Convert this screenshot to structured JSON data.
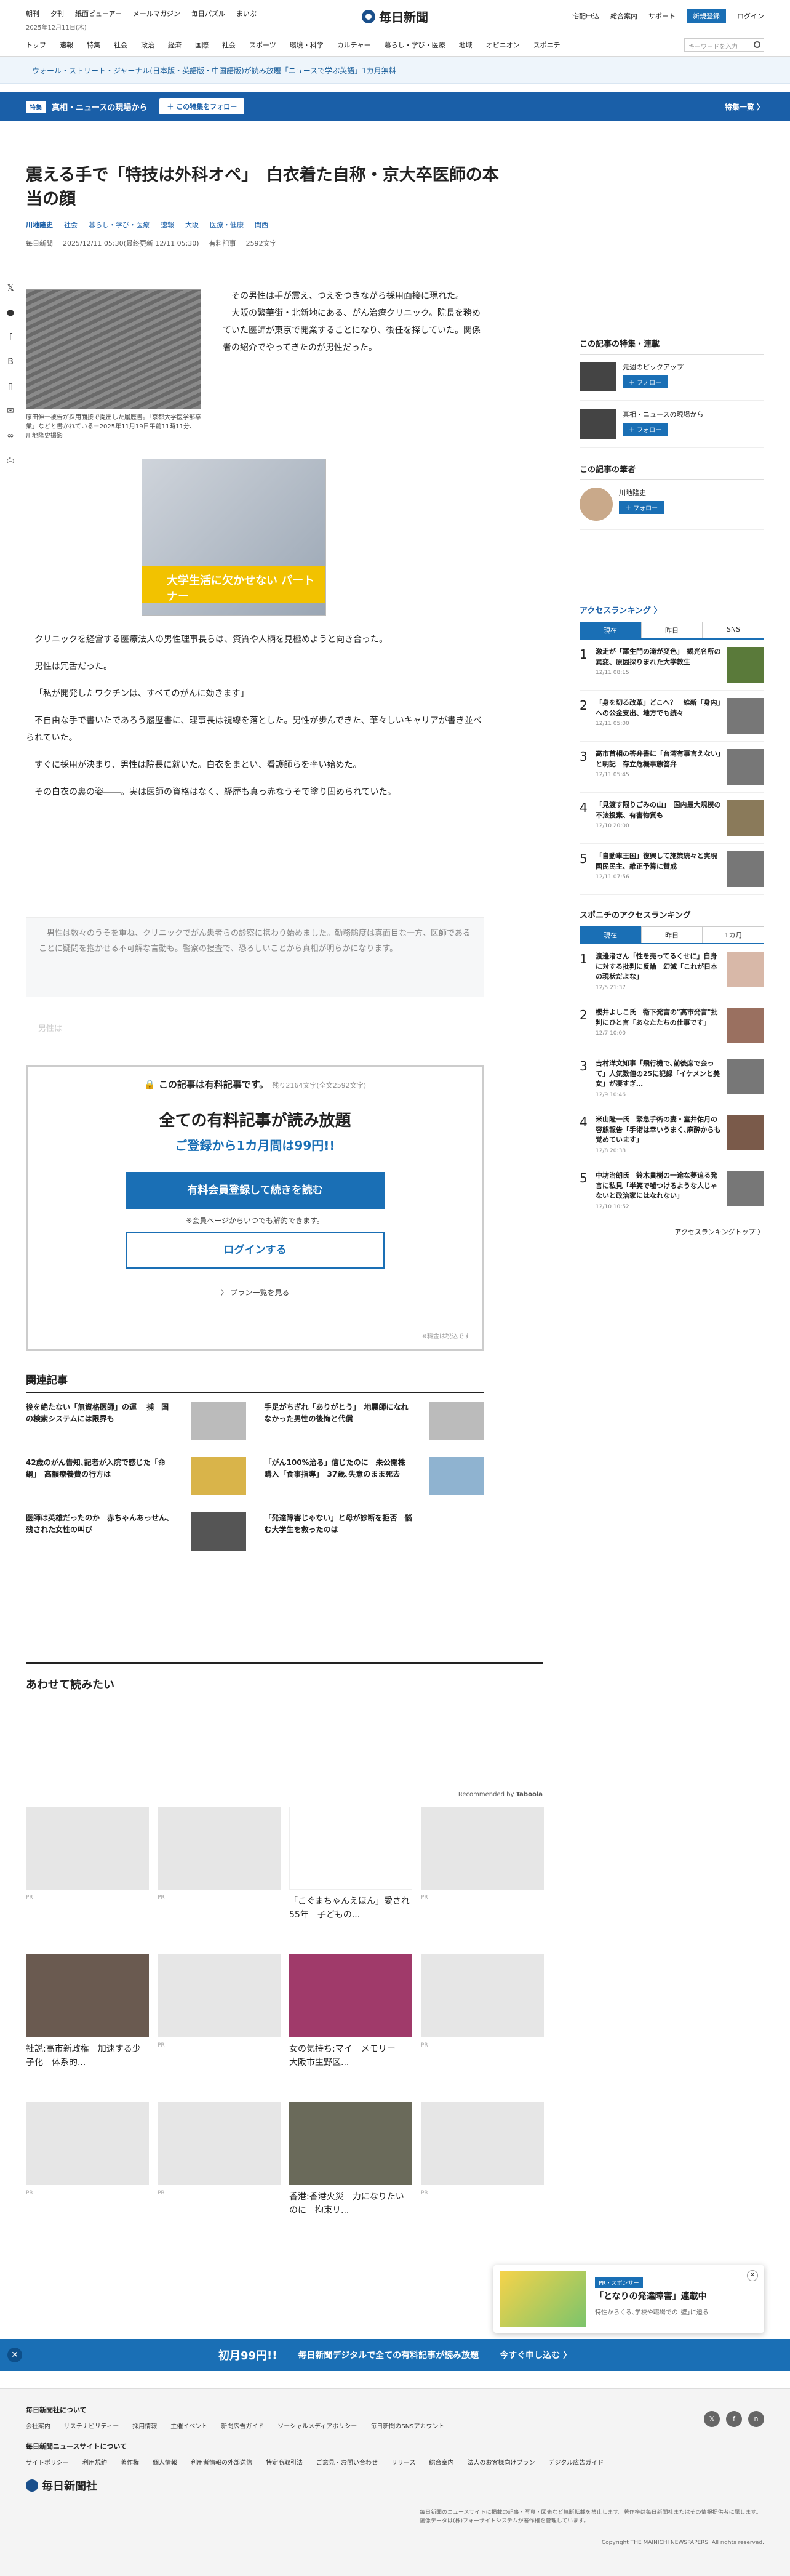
{
  "topbar": {
    "links": [
      "朝刊",
      "夕刊",
      "紙面ビューアー",
      "メールマガジン",
      "毎日パズル",
      "まいぷ"
    ],
    "date": "2025年12月11日(木)",
    "logo": "毎日新聞",
    "right": [
      "宅配申込",
      "総合案内",
      "サポート"
    ],
    "register": "新規登録",
    "login": "ログイン"
  },
  "nav": {
    "items": [
      "トップ",
      "速報",
      "特集",
      "社会",
      "政治",
      "経済",
      "国際",
      "社会",
      "スポーツ",
      "環境・科学",
      "カルチャー",
      "暮らし・学び・医療",
      "地域",
      "オピニオン",
      "スポニチ"
    ],
    "search_placeholder": "キーワードを入力"
  },
  "promo": {
    "text": "ウォール・ストリート・ジャーナル(日本版・英語版・中国語版)が読み放題「ニュースで学ぶ英語」1カ月無料"
  },
  "special": {
    "tag": "特集",
    "title": "真相・ニュースの現場から",
    "follow": "＋ この特集をフォロー",
    "all": "特集一覧 〉"
  },
  "article": {
    "title": "震える手で「特技は外科オペ」　白衣着た自称・京大卒医師の本当の顔",
    "author": "川地隆史",
    "tags": [
      "社会",
      "暮らし・学び・医療",
      "速報",
      "大阪",
      "医療・健康",
      "関西"
    ],
    "source": "毎日新聞",
    "date": "2025/12/11 05:30(最終更新 12/11 05:30)",
    "save": "有料記事",
    "chars": "2592文字",
    "caption": "原田伸一被告が採用面接で提出した履歴書。「京都大学医学部卒業」などと書かれている＝2025年11月19日午前11時11分、川地隆史撮影",
    "lead": "　その男性は手が震え、つえをつきながら採用面接に現れた。\n　大阪の繁華街・北新地にある、がん治療クリニック。院長を務めていた医師が東京で開業することになり、後任を探していた。関係者の紹介でやってきたのが男性だった。",
    "ad_text": "大学生活に欠かせない パートナー",
    "paras": [
      "クリニックを経営する医療法人の男性理事長らは、資質や人柄を見極めようと向き合った。",
      "男性は冗舌だった。",
      "「私が開発したワクチンは、すべてのがんに効きます」",
      "不自由な手で書いたであろう履歴書に、理事長は視線を落とした。男性が歩んできた、華々しいキャリアが書き並べられていた。",
      "すぐに採用が決まり、男性は院長に就いた。白衣をまとい、看護師らを率い始めた。",
      "その白衣の裏の姿――。実は医師の資格はなく、経歴も真っ赤なうそで塗り固められていた。"
    ],
    "faded": "　男性は数々のうそを重ね、クリニックでがん患者らの診察に携わり始めました。勤務態度は真面目な一方、医師であることに疑問を抱かせる不可解な言動も。警察の捜査で、恐ろしいことから真相が明らかになります。",
    "faded2": "男性は"
  },
  "paywall": {
    "head": "この記事は有料記事です。",
    "remain": "残り2164文字(全文2592文字)",
    "title": "全ての有料記事が読み放題",
    "sub": "ご登録から1カ月間は99円!!",
    "register": "有料会員登録して続きを読む",
    "note": "※会員ページからいつでも解約できます。",
    "login": "ログインする",
    "plan": "〉 プラン一覧を見る",
    "foot": "※料金は税込です"
  },
  "related": {
    "title": "関連記事",
    "items": [
      "後を絶たない「無資格医師」の運 　捕　国の検索システムには限界も",
      "手足がちぎれ「ありがとう」　地震師になれなかった男性の後悔と代償",
      "42歳のがん告知､記者が入院で感じた「命綱」　高額療養費の行方は",
      "「がん100%治る」信じたのに　未公開株購入「食事指導」　37歳､失意のまま死去",
      "医師は英雄だったのか　赤ちゃんあっせん､残された女性の叫び",
      "「発達障害じゃない」と母が診断を拒否　悩む大学生を救ったのは"
    ]
  },
  "also": {
    "title": "あわせて読みたい",
    "recby": "Recommended by",
    "cards": [
      "",
      "",
      "「こぐまちゃんえほん」愛され55年　子どもの...",
      "",
      "社説:高市新政権　加速する少子化　体系的...",
      "",
      "女の気持ち:マイ　メモリー　大阪市生野区...",
      "",
      "",
      "",
      "香港:香港火災　力になりたいのに　拘束リ...",
      ""
    ],
    "pr": "PR"
  },
  "sidebar": {
    "series_title": "この記事の特集・連載",
    "series": [
      "先週のピックアップ",
      "真相・ニュースの現場から"
    ],
    "follow": "＋ フォロー",
    "author_title": "この記事の筆者",
    "author": "川地隆史",
    "rank1": {
      "title": "アクセスランキング 〉",
      "tabs": [
        "現在",
        "昨日",
        "SNS"
      ],
      "items": [
        {
          "t": "激走が「羅生門の滝が変色」　観光名所の異変、原因探りまれた大学教生",
          "d": "12/11 08:15"
        },
        {
          "t": "「身を切る改革」どこへ？　維新「身内」への公金支出、地方でも続々",
          "d": "12/11 05:00"
        },
        {
          "t": "高市首相の答弁書に「台湾有事言えない」と明記　存立危機事態答弁",
          "d": "12/11 05:45"
        },
        {
          "t": "「見渡す限りごみの山」　国内最大規模の不法投棄、有害物質も",
          "d": "12/10 20:00"
        },
        {
          "t": "「自動車王国」復興して施策続々と実現　国民民主、維正予算に賛成",
          "d": "12/11 07:56"
        }
      ]
    },
    "rank2": {
      "title": "スポニチのアクセスランキング",
      "tabs": [
        "現在",
        "昨日",
        "1カ月"
      ],
      "items": [
        {
          "t": "渡邊渚さん「性を売ってるくせに」自身に対する批判に反論　幻滅「これが日本の現状だよな」",
          "d": "12/5 21:37"
        },
        {
          "t": "櫻井よしこ氏　衛下発言の\"高市発言\"批判にひと言「あなたたちの仕事です」",
          "d": "12/7 10:00"
        },
        {
          "t": "吉村洋文知事「飛行機で､前後席で会って」人気数値の25に記録「イケメンと美女」が凄すぎ…",
          "d": "12/9 10:46"
        },
        {
          "t": "米山隆一氏　緊急手術の妻・室井佑月の容態報告「手術は幸いうまく､麻酔からも覚めています」",
          "d": "12/8 20:38"
        },
        {
          "t": "中坊治朗氏　鈴木貴樹の一途な夢追る発言に私見「半笑で嘘つけるような人じゃないと政治家にはなれない」",
          "d": "12/10 10:52"
        }
      ],
      "more": "アクセスランキングトップ 〉"
    }
  },
  "sticky": {
    "big": "初月99円!!",
    "text": "毎日新聞デジタルで全ての有料記事が読み放題",
    "cta": "今すぐ申し込む 〉"
  },
  "popup": {
    "tag": "PR・スポンサー",
    "title": "「となりの発達障害」連載中",
    "sub": "特性からくる､学校や職場での｢壁｣に迫る"
  },
  "footer": {
    "h1": "毎日新聞社について",
    "links1": [
      "会社案内",
      "サステナビリティー",
      "採用情報",
      "主催イベント",
      "新聞広告ガイド",
      "ソーシャルメディアポリシー",
      "毎日新聞のSNSアカウント"
    ],
    "h2": "毎日新聞ニュースサイトについて",
    "links2": [
      "サイトポリシー",
      "利用規約",
      "著作権",
      "個人情報",
      "利用者情報の外部送信",
      "特定商取引法",
      "ご意見・お問い合わせ",
      "リリース",
      "総合案内",
      "法人のお客様向けプラン",
      "デジタル広告ガイド"
    ],
    "logo": "毎日新聞社",
    "note": "毎日新聞のニュースサイトに掲載の記事・写真・図表など無断転載を禁止します。著作権は毎日新聞社またはその情報提供者に属します。画像データは(株)フォーサイトシステムが著作権を管理しています。",
    "copy": "Copyright THE MAINICHI NEWSPAPERS. All rights reserved."
  }
}
